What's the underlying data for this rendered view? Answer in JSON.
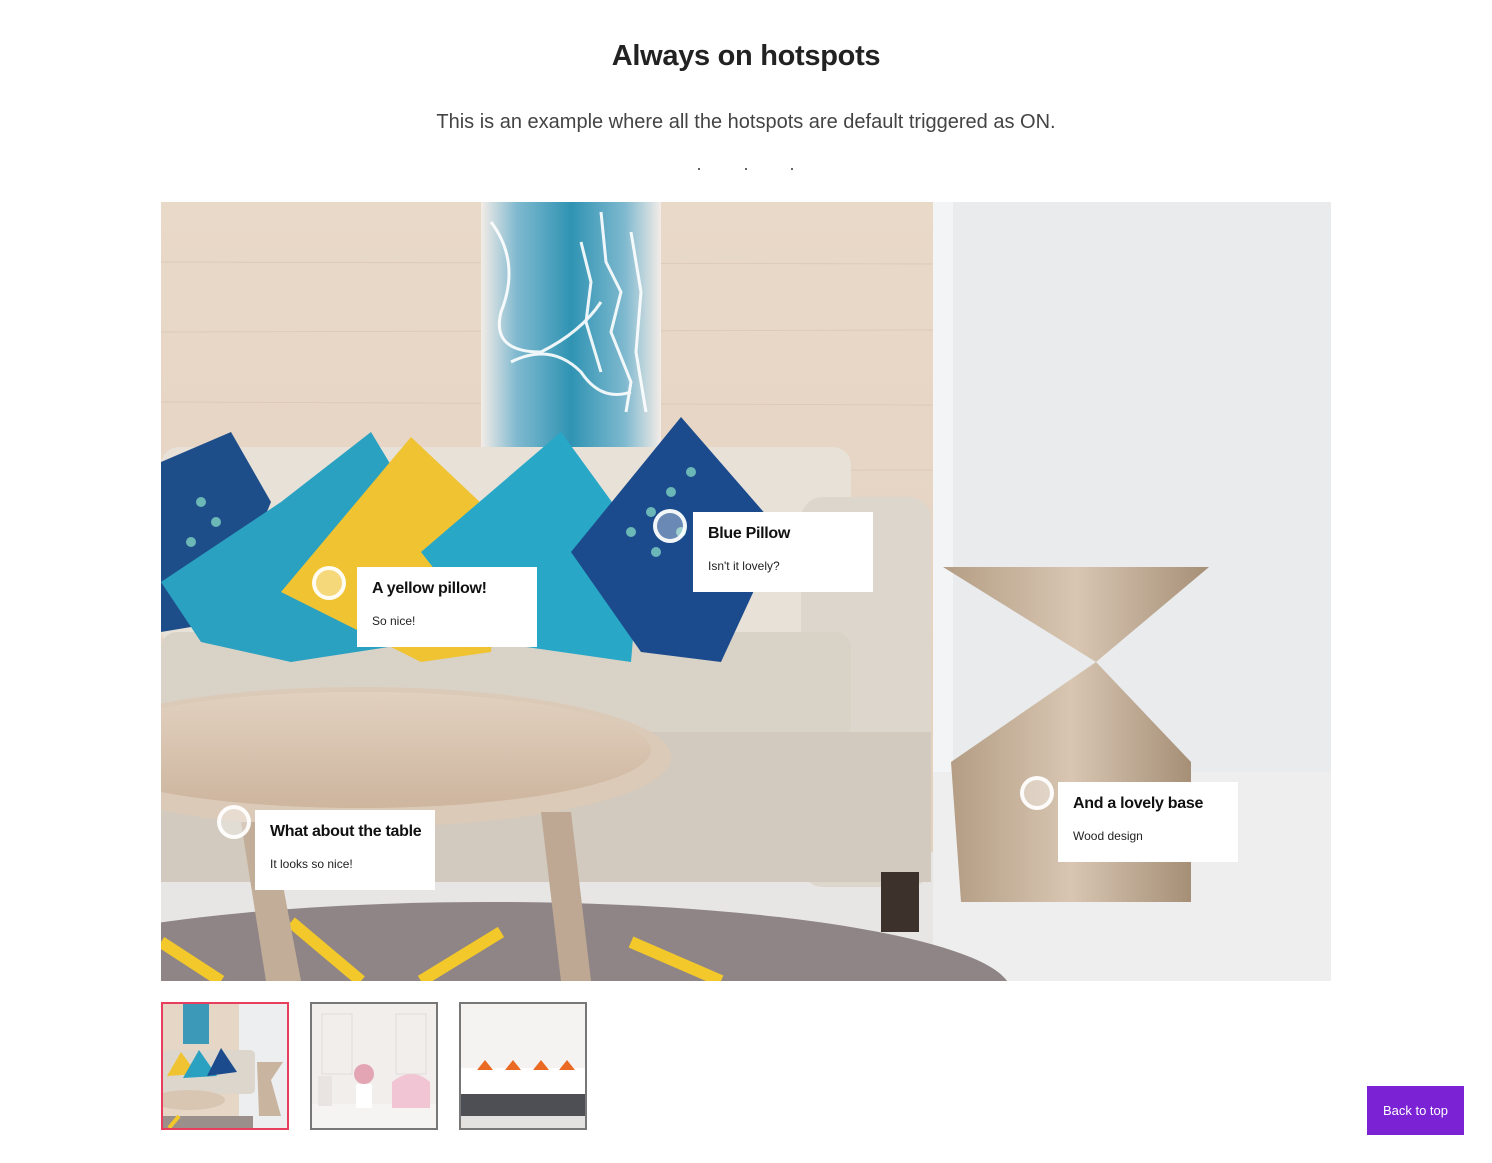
{
  "header": {
    "title": "Always on hotspots",
    "subtitle": "This is an example where all the hotspots are default triggered as ON."
  },
  "hotspots": [
    {
      "title": "A yellow pillow!",
      "description": "So nice!"
    },
    {
      "title": "Blue Pillow",
      "description": "Isn't it lovely?"
    },
    {
      "title": "What about the table",
      "description": "It looks so nice!"
    },
    {
      "title": "And a lovely base",
      "description": "Wood design"
    }
  ],
  "gallery": {
    "active_index": 0,
    "thumbnail_count": 3
  },
  "footer": {
    "back_to_top_label": "Back to top"
  },
  "colors": {
    "accent": "#7b22d4",
    "active_thumb_border": "#e83e5e"
  }
}
